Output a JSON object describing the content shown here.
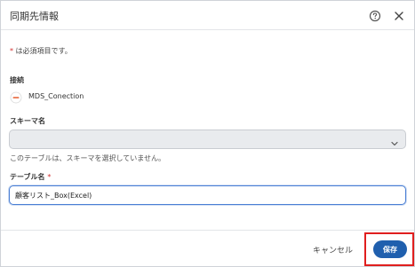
{
  "dialog": {
    "title": "同期先情報",
    "help_icon": "help-circle-icon",
    "close_icon": "close-icon"
  },
  "form": {
    "required_star": "*",
    "required_note": " は必須項目です。",
    "connection_label": "接続",
    "connection_icon": "connection-icon",
    "connection_name": "MDS_Conection",
    "schema_label": "スキーマ名",
    "schema_value": "",
    "schema_hint": "このテーブルは、スキーマを選択していません。",
    "table_label": "テーブル名",
    "table_required_star": "*",
    "table_value": "顧客リスト_Box(Excel)"
  },
  "footer": {
    "cancel_label": "キャンセル",
    "save_label": "保存"
  },
  "colors": {
    "primary": "#1f5fae",
    "required": "#d32f2f",
    "highlight": "#e01e1e"
  }
}
